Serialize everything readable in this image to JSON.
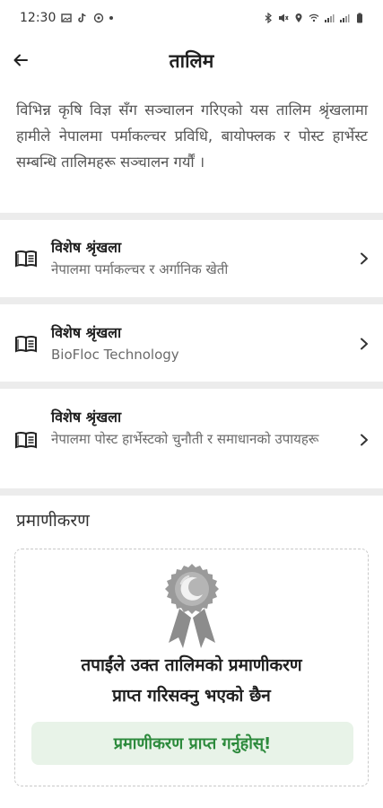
{
  "status_bar": {
    "time": "12:30"
  },
  "header": {
    "title": "तालिम"
  },
  "intro": "विभिन्न कृषि विज्ञ सँग सञ्चालन गरिएको यस तालिम श्रृंखलामा हामीले नेपालमा पर्माकल्चर प्रविधि, बायोफ्लक र पोस्ट हार्भेस्ट सम्बन्धि तालिमहरू सञ्चालन गर्यौं ।",
  "series": [
    {
      "title": "विशेष श्रृंखला",
      "subtitle": "नेपालमा पर्माकल्चर र अर्गानिक खेती"
    },
    {
      "title": "विशेष श्रृंखला",
      "subtitle": "BioFloc Technology"
    },
    {
      "title": "विशेष श्रृंखला",
      "subtitle": "नेपालमा पोस्ट हार्भेस्टको चुनौती र समाधानको उपायहरू"
    }
  ],
  "certification": {
    "heading": "प्रमाणीकरण",
    "message_line1": "तपाईंले उक्त तालिमको प्रमाणीकरण",
    "message_line2": "प्राप्त गरिसक्नु भएको छैन",
    "button_label": "प्रमाणीकरण प्राप्त गर्नुहोस्!"
  },
  "colors": {
    "accent_green": "#2c8a3c",
    "button_bg": "#e8f3e8",
    "separator": "#ececec"
  }
}
